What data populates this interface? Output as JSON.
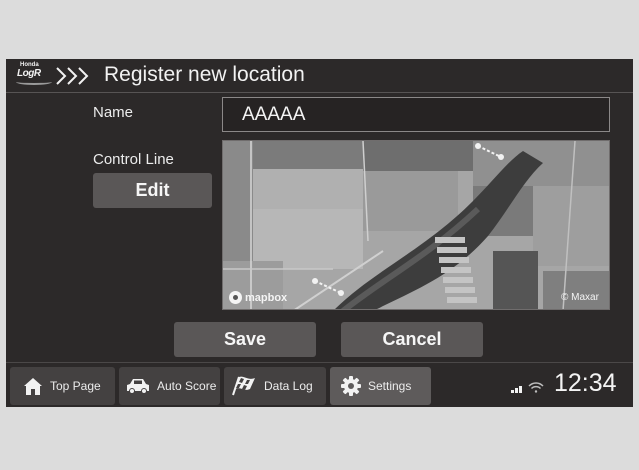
{
  "app": {
    "brand": "Honda",
    "logo_text": "LogR"
  },
  "header": {
    "title": "Register new location"
  },
  "form": {
    "name_label": "Name",
    "name_value": "AAAAA",
    "control_line_label": "Control Line",
    "edit_label": "Edit"
  },
  "map": {
    "attribution_left": "mapbox",
    "attribution_right": "© Maxar"
  },
  "actions": {
    "save_label": "Save",
    "cancel_label": "Cancel"
  },
  "nav": {
    "items": [
      {
        "label": "Top Page",
        "icon": "home-icon"
      },
      {
        "label": "Auto Score",
        "icon": "car-icon"
      },
      {
        "label": "Data Log",
        "icon": "checkered-flag-icon"
      },
      {
        "label": "Settings",
        "icon": "gear-icon",
        "active": true
      }
    ]
  },
  "status": {
    "time": "12:34"
  },
  "colors": {
    "background": "#2c2929",
    "button": "#5a5757",
    "active_nav": "#5e5b5b",
    "text": "#f2f2f2"
  }
}
